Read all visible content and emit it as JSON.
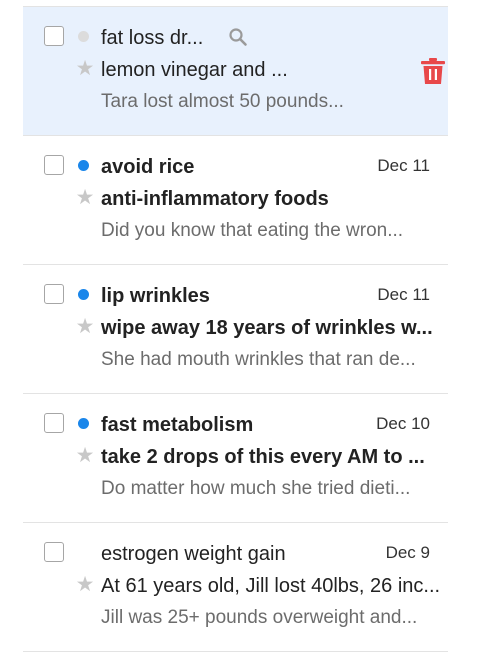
{
  "colors": {
    "accent": "#1a86ea",
    "selected_row_bg": "#e8f1fd",
    "delete": "#e8484a"
  },
  "messages": [
    {
      "sender": "fat loss dr...",
      "subject": "lemon vinegar and ...",
      "preview": "Tara lost almost 50 pounds...",
      "date": "",
      "unread": false,
      "selected": true,
      "hover_actions": [
        "search-icon",
        "trash-icon"
      ]
    },
    {
      "sender": "avoid rice",
      "subject": "anti-inflammatory foods",
      "preview": "Did you know that eating the wron...",
      "date": "Dec 11",
      "unread": true,
      "selected": false
    },
    {
      "sender": "lip wrinkles",
      "subject": "wipe away 18 years of wrinkles w...",
      "preview": "She had mouth wrinkles that ran de...",
      "date": "Dec 11",
      "unread": true,
      "selected": false
    },
    {
      "sender": "fast metabolism",
      "subject": "take 2 drops of this every AM to ...",
      "preview": "Do matter how much she tried dieti...",
      "date": "Dec 10",
      "unread": true,
      "selected": false
    },
    {
      "sender": "estrogen weight gain",
      "subject": "At 61 years old, Jill lost 40lbs, 26 inc...",
      "preview": "Jill was 25+ pounds overweight and...",
      "date": "Dec 9",
      "unread": false,
      "selected": false
    }
  ]
}
